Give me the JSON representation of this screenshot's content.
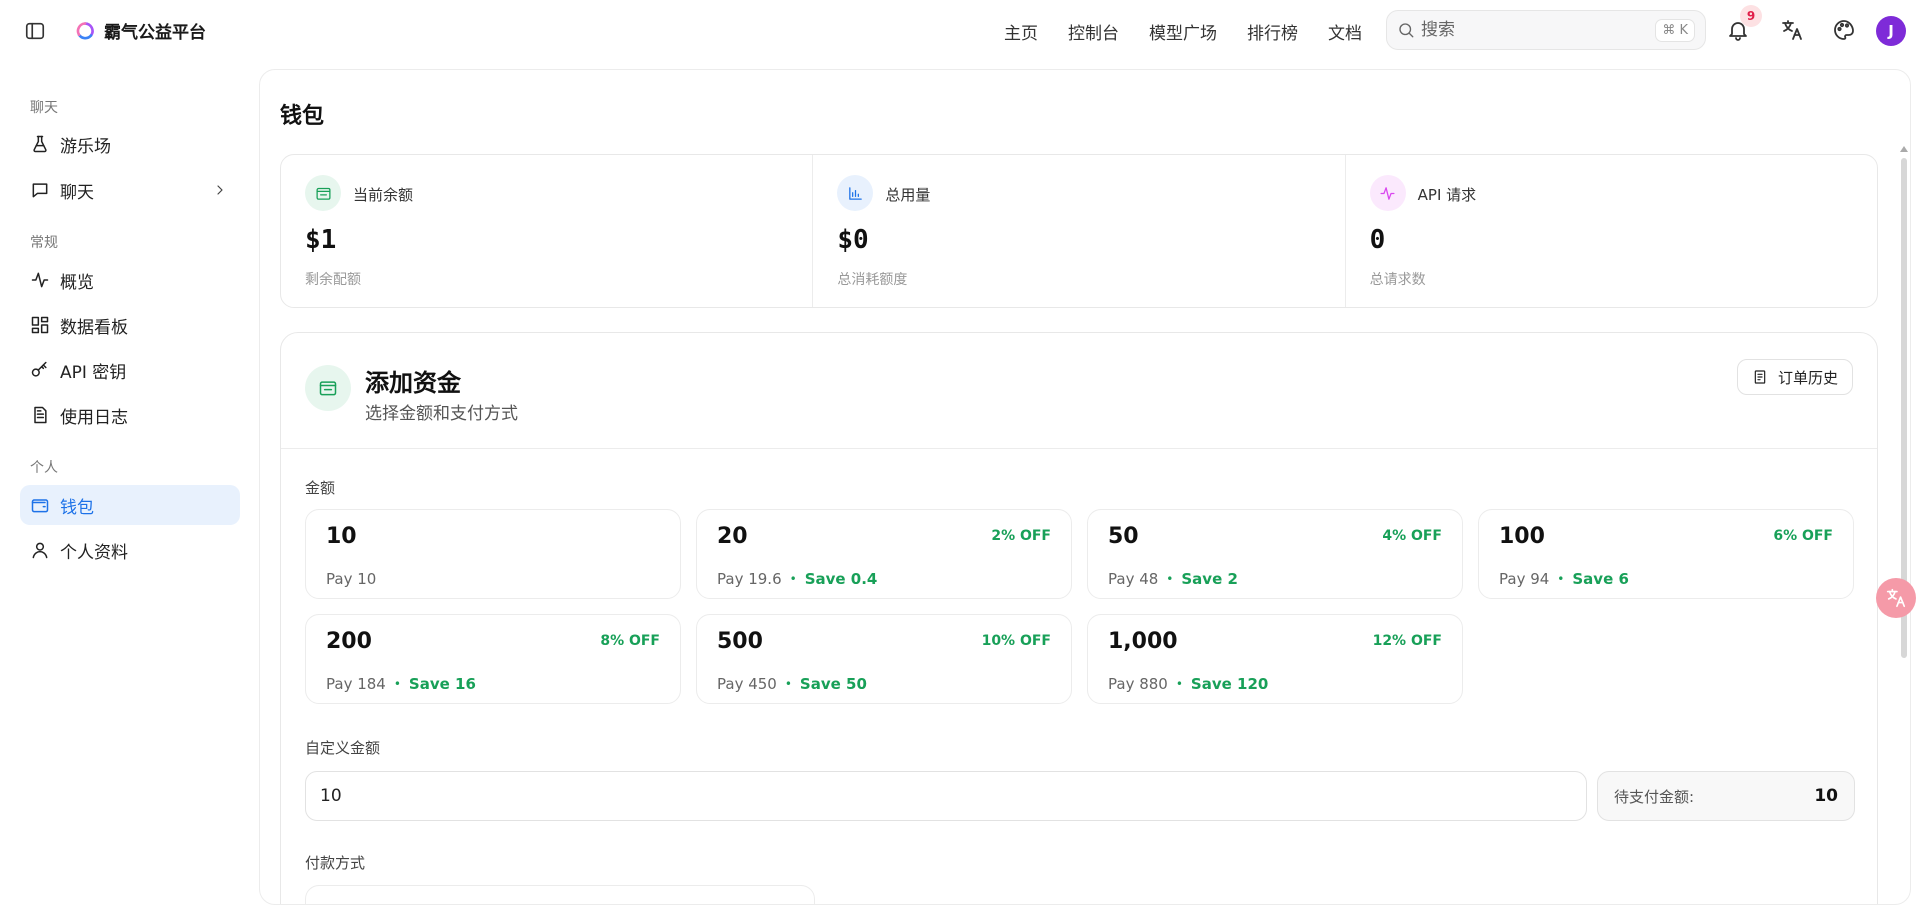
{
  "app": {
    "name": "霸气公益平台"
  },
  "topnav": [
    {
      "label": "主页"
    },
    {
      "label": "控制台"
    },
    {
      "label": "模型广场"
    },
    {
      "label": "排行榜"
    },
    {
      "label": "文档"
    }
  ],
  "search": {
    "placeholder": "搜索",
    "shortcut": "⌘ K"
  },
  "notifications": {
    "count": "9"
  },
  "user": {
    "initial": "J"
  },
  "sidebar": {
    "sections": [
      {
        "title": "聊天"
      },
      {
        "title": "常规"
      },
      {
        "title": "个人"
      }
    ],
    "items": [
      {
        "label": "游乐场",
        "icon": "flask-icon"
      },
      {
        "label": "聊天",
        "icon": "chat-icon"
      },
      {
        "label": "概览",
        "icon": "activity-icon"
      },
      {
        "label": "数据看板",
        "icon": "dashboard-icon"
      },
      {
        "label": "API 密钥",
        "icon": "key-icon"
      },
      {
        "label": "使用日志",
        "icon": "document-icon"
      },
      {
        "label": "钱包",
        "icon": "wallet-icon",
        "active": true
      },
      {
        "label": "个人资料",
        "icon": "user-icon"
      }
    ]
  },
  "page": {
    "title": "钱包"
  },
  "stats": [
    {
      "label": "当前余额",
      "value": "$1",
      "sub": "剩余配额",
      "color": "#18a058"
    },
    {
      "label": "总用量",
      "value": "$0",
      "sub": "总消耗额度",
      "color": "#1d72e8"
    },
    {
      "label": "API 请求",
      "value": "0",
      "sub": "总请求数",
      "color": "#d946ef"
    }
  ],
  "funds": {
    "title": "添加资金",
    "subtitle": "选择金额和支付方式",
    "order_history": "订单历史",
    "amount_label": "金额",
    "custom_label": "自定义金额",
    "custom_value": "10",
    "pending_label": "待支付金额:",
    "pending_value": "10",
    "payment_label": "付款方式"
  },
  "amounts": [
    {
      "amount": "10",
      "off": "",
      "pay": "Pay 10",
      "save": ""
    },
    {
      "amount": "20",
      "off": "2% OFF",
      "pay": "Pay 19.6",
      "save": "Save 0.4"
    },
    {
      "amount": "50",
      "off": "4% OFF",
      "pay": "Pay 48",
      "save": "Save 2"
    },
    {
      "amount": "100",
      "off": "6% OFF",
      "pay": "Pay 94",
      "save": "Save 6"
    },
    {
      "amount": "200",
      "off": "8% OFF",
      "pay": "Pay 184",
      "save": "Save 16"
    },
    {
      "amount": "500",
      "off": "10% OFF",
      "pay": "Pay 450",
      "save": "Save 50"
    },
    {
      "amount": "1,000",
      "off": "12% OFF",
      "pay": "Pay 880",
      "save": "Save 120"
    }
  ],
  "colors": {
    "accent": "#1d72e8",
    "success": "#18a058",
    "avatar": "#7e2bd8"
  }
}
